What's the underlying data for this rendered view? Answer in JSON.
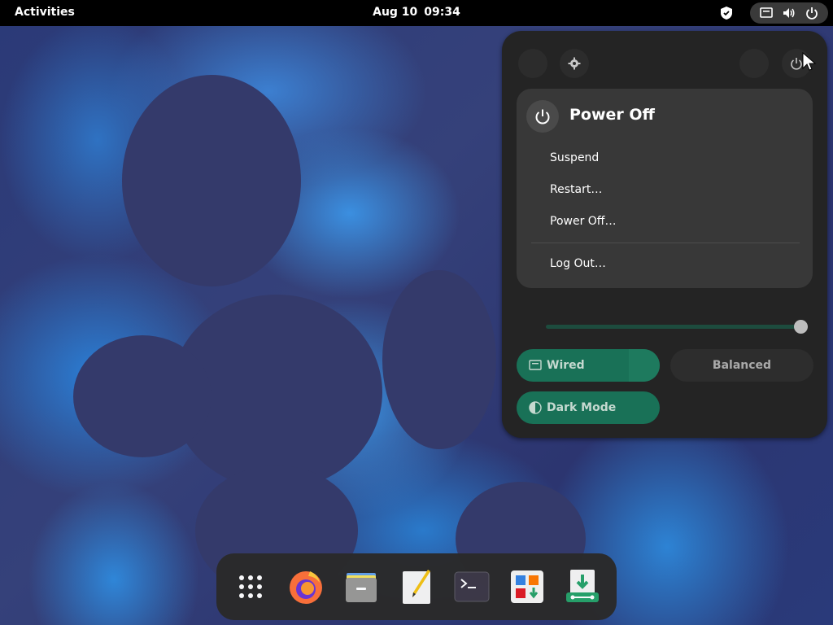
{
  "topbar": {
    "activities": "Activities",
    "date": "Aug 10",
    "time": "09:34"
  },
  "power_menu": {
    "title": "Power Off",
    "items": [
      "Suspend",
      "Restart…",
      "Power Off…",
      "Log Out…"
    ]
  },
  "volume_level": 0.95,
  "toggles": {
    "wired": "Wired",
    "balanced": "Balanced",
    "dark_mode": "Dark Mode"
  },
  "dock_apps": [
    "show-apps-icon",
    "firefox-icon",
    "files-icon",
    "text-editor-icon",
    "terminal-icon",
    "software-icon",
    "update-icon"
  ],
  "colors": {
    "accent": "#197157",
    "panel": "#242424",
    "submenu": "#383838"
  }
}
